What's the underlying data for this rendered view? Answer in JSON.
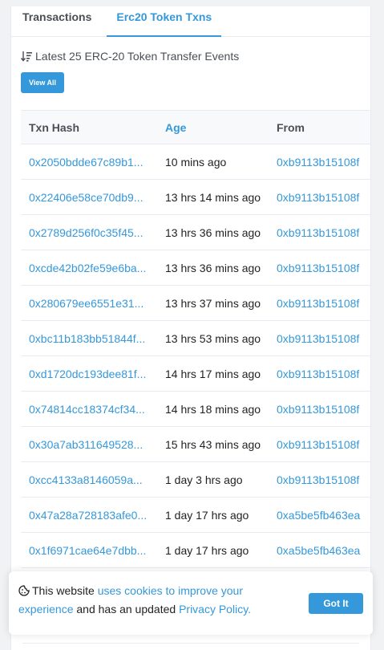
{
  "tabs": [
    {
      "label": "Transactions"
    },
    {
      "label": "Erc20 Token Txns"
    }
  ],
  "header": {
    "latest_text": "Latest 25 ERC-20 Token Transfer Events",
    "view_all_label": "View All"
  },
  "table": {
    "columns": [
      "Txn Hash",
      "Age",
      "From"
    ],
    "rows": [
      {
        "hash": "0x2050bdde67c89b1...",
        "age": "10 mins ago",
        "from": "0xb9113b15108f"
      },
      {
        "hash": "0x22406e58ce70db9...",
        "age": "13 hrs 14 mins ago",
        "from": "0xb9113b15108f"
      },
      {
        "hash": "0x2789d256f0c35f45...",
        "age": "13 hrs 36 mins ago",
        "from": "0xb9113b15108f"
      },
      {
        "hash": "0xcde42b02fe59e6ba...",
        "age": "13 hrs 36 mins ago",
        "from": "0xb9113b15108f"
      },
      {
        "hash": "0x280679ee6551e31...",
        "age": "13 hrs 37 mins ago",
        "from": "0xb9113b15108f"
      },
      {
        "hash": "0xbc11b183bb51844f...",
        "age": "13 hrs 53 mins ago",
        "from": "0xb9113b15108f"
      },
      {
        "hash": "0xd1720dc193dee81f...",
        "age": "14 hrs 17 mins ago",
        "from": "0xb9113b15108f"
      },
      {
        "hash": "0x74814cc18374cf34...",
        "age": "14 hrs 18 mins ago",
        "from": "0xb9113b15108f"
      },
      {
        "hash": "0x30a7ab311649528...",
        "age": "15 hrs 43 mins ago",
        "from": "0xb9113b15108f"
      },
      {
        "hash": "0xcc4133a8146059a...",
        "age": "1 day 3 hrs ago",
        "from": "0xb9113b15108f"
      },
      {
        "hash": "0x47a28a728183afe0...",
        "age": "1 day 17 hrs ago",
        "from": "0xa5be5fb463ea"
      },
      {
        "hash": "0x1f6971cae64e7dbb...",
        "age": "1 day 17 hrs ago",
        "from": "0xa5be5fb463ea"
      }
    ]
  },
  "cookie": {
    "prefix": "This website ",
    "link1": "uses cookies to improve your experience",
    "middle": " and has an updated ",
    "link2": "Privacy Policy.",
    "button_label": "Got It"
  },
  "colors": {
    "accent": "#3498db",
    "text": "#1e2022",
    "muted": "#4a4f55",
    "border": "#e7eaf3"
  }
}
